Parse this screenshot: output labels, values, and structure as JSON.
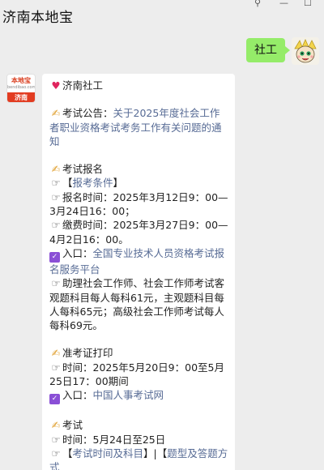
{
  "header": {
    "title": "济南本地宝"
  },
  "chat": {
    "user_message": "社工",
    "bot_avatar": {
      "top_text": "本地宝",
      "sub_text": "bendibao.com",
      "bottom_text": "济南"
    },
    "reply": {
      "heading": "济南社工",
      "announce_label": "考试公告：",
      "announce_link": "关于2025年度社会工作者职业资格考试考务工作有关问题的通知",
      "reg_title": "考试报名",
      "reg_cond_open": "【",
      "reg_cond_link": "报考条件",
      "reg_cond_close": "】",
      "reg_time": "报名时间：2025年3月12日9：00—3月24日16：00；",
      "pay_time": "缴费时间：2025年3月27日9：00—4月2日16：00。",
      "entry1_label": "入口：",
      "entry1_link": "全国专业技术人员资格考试报名服务平台",
      "fee_text": "助理社会工作师、社会工作师考试客观题科目每人每科61元，主观题科目每人每科65元；高级社会工作师考试每人每科69元。",
      "admit_title": "准考证打印",
      "admit_time": "时间：2025年5月20日9：00至5月25日17：00期间",
      "entry2_label": "入口：",
      "entry2_link": "中国人事考试网",
      "exam_title": "考试",
      "exam_time": "时间：5月24日至25日",
      "exam_link1": "考试时间及科目",
      "exam_sep": "】|【",
      "exam_link2": "题型及答题方式"
    }
  }
}
